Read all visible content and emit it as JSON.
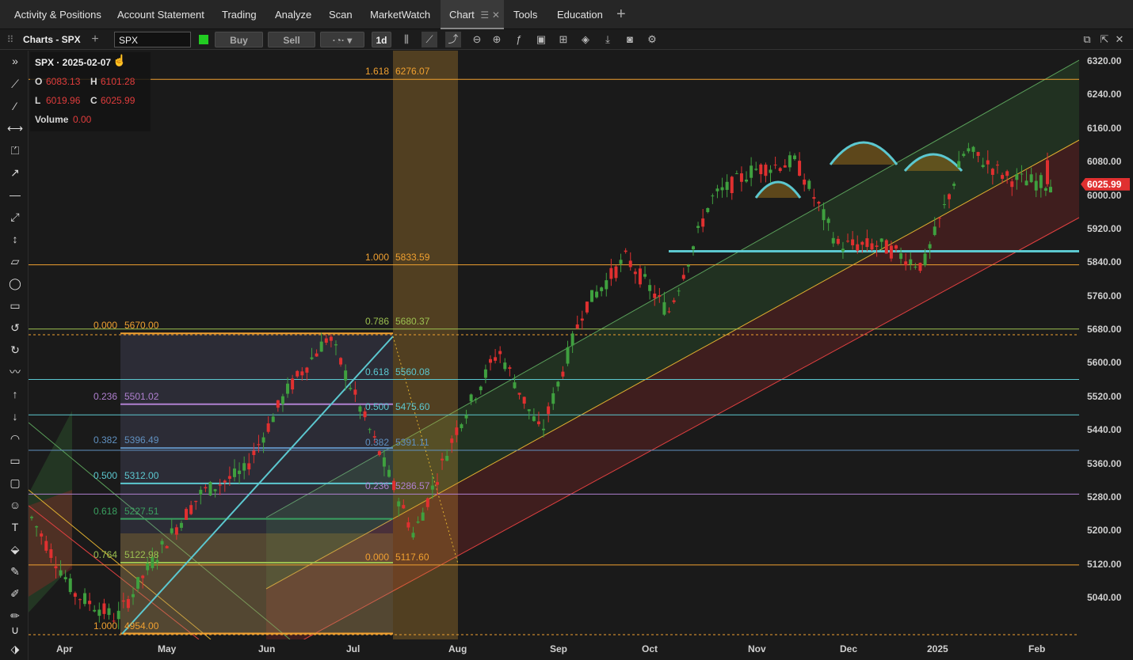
{
  "nav": {
    "tabs": [
      "Activity & Positions",
      "Account Statement",
      "Trading",
      "Analyze",
      "Scan",
      "MarketWatch",
      "Chart",
      "Tools",
      "Education"
    ],
    "active_tab": "Chart"
  },
  "toolbar": {
    "title": "Charts - SPX",
    "symbol_value": "SPX",
    "buy_label": "Buy",
    "sell_label": "Sell",
    "timeframe": "1d"
  },
  "legend": {
    "symbol_date": "SPX · 2025-02-07",
    "o_label": "O",
    "o_value": "6083.13",
    "h_label": "H",
    "h_value": "6101.28",
    "l_label": "L",
    "l_value": "6019.96",
    "c_label": "C",
    "c_value": "6025.99",
    "volume_label": "Volume",
    "volume_value": "0.00"
  },
  "price_badge": "6025.99",
  "colors": {
    "up": "#3fa03f",
    "down": "#e03030",
    "fib_orange": "#f0a030",
    "channel_green": "#3a7a3a",
    "channel_red": "#8a2a2a",
    "cyan": "#5cc8d0"
  },
  "chart_data": {
    "type": "candlestick",
    "title": "SPX",
    "ylim": [
      4960,
      6360
    ],
    "y_ticks": [
      "6320.00",
      "6240.00",
      "6160.00",
      "6080.00",
      "6000.00",
      "5920.00",
      "5840.00",
      "5760.00",
      "5680.00",
      "5600.00",
      "5520.00",
      "5440.00",
      "5360.00",
      "5280.00",
      "5200.00",
      "5120.00",
      "5040.00"
    ],
    "x_ticks": [
      "Apr",
      "May",
      "Jun",
      "Jul",
      "Aug",
      "Sep",
      "Oct",
      "Nov",
      "Dec",
      "2025",
      "Feb"
    ],
    "last_price": 6025.99,
    "fib_levels_left": [
      {
        "ratio": "0.000",
        "price": "5670.00"
      },
      {
        "ratio": "0.236",
        "price": "5501.02"
      },
      {
        "ratio": "0.382",
        "price": "5396.49"
      },
      {
        "ratio": "0.500",
        "price": "5312.00"
      },
      {
        "ratio": "0.618",
        "price": "5227.51"
      },
      {
        "ratio": "0.764",
        "price": "5122.98"
      },
      {
        "ratio": "1.000",
        "price": "4954.00"
      }
    ],
    "fib_levels_right": [
      {
        "ratio": "1.618",
        "price": "6276.07"
      },
      {
        "ratio": "1.000",
        "price": "5833.59"
      },
      {
        "ratio": "0.786",
        "price": "5680.37"
      },
      {
        "ratio": "0.618",
        "price": "5560.08"
      },
      {
        "ratio": "0.500",
        "price": "5475.60"
      },
      {
        "ratio": "0.382",
        "price": "5391.11"
      },
      {
        "ratio": "0.236",
        "price": "5286.57"
      },
      {
        "ratio": "0.000",
        "price": "5117.60"
      }
    ],
    "support_line": 5866,
    "monthly_path": [
      {
        "x": "Apr",
        "price": 5230
      },
      {
        "x": "Apr-end",
        "price": 5050
      },
      {
        "x": "May",
        "price": 4990
      },
      {
        "x": "May-mid",
        "price": 5150
      },
      {
        "x": "Jun",
        "price": 5290
      },
      {
        "x": "Jun-mid",
        "price": 5340
      },
      {
        "x": "Jul",
        "price": 5530
      },
      {
        "x": "Jul-mid",
        "price": 5665
      },
      {
        "x": "Jul-end",
        "price": 5430
      },
      {
        "x": "Aug",
        "price": 5190
      },
      {
        "x": "Aug-mid",
        "price": 5440
      },
      {
        "x": "Sep",
        "price": 5630
      },
      {
        "x": "Sep-mid",
        "price": 5430
      },
      {
        "x": "Oct",
        "price": 5730
      },
      {
        "x": "Oct-mid",
        "price": 5850
      },
      {
        "x": "Nov",
        "price": 5720
      },
      {
        "x": "Nov-mid",
        "price": 5990
      },
      {
        "x": "Dec",
        "price": 6060
      },
      {
        "x": "Dec-mid",
        "price": 6080
      },
      {
        "x": "Dec-end",
        "price": 5880
      },
      {
        "x": "2025",
        "price": 5880
      },
      {
        "x": "Jan-mid",
        "price": 5830
      },
      {
        "x": "Jan-end",
        "price": 6110
      },
      {
        "x": "Feb",
        "price": 6040
      },
      {
        "x": "Feb-7",
        "price": 6026
      }
    ]
  }
}
